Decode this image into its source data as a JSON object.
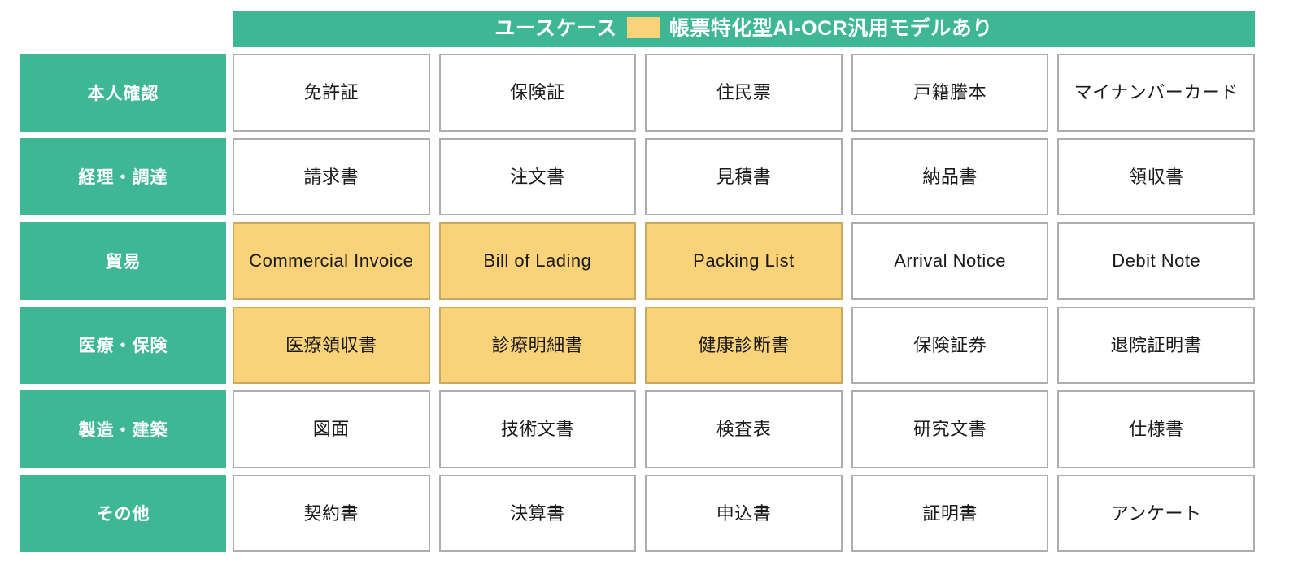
{
  "header": {
    "title": "ユースケース",
    "legend_swatch_color": "#FAD27A",
    "legend_label": "帳票特化型AI-OCR汎用モデルあり",
    "background_color": "#3FB795"
  },
  "colors": {
    "accent_green": "#3FB795",
    "highlight_yellow": "#FAD27A",
    "cell_border": "#ADADAD",
    "text": "#1a1a1a",
    "label_text": "#ffffff"
  },
  "rows": [
    {
      "label": "本人確認",
      "cells": [
        {
          "text": "免許証",
          "highlighted": false
        },
        {
          "text": "保険証",
          "highlighted": false
        },
        {
          "text": "住民票",
          "highlighted": false
        },
        {
          "text": "戸籍謄本",
          "highlighted": false
        },
        {
          "text": "マイナンバーカード",
          "highlighted": false
        }
      ]
    },
    {
      "label": "経理・調達",
      "cells": [
        {
          "text": "請求書",
          "highlighted": false
        },
        {
          "text": "注文書",
          "highlighted": false
        },
        {
          "text": "見積書",
          "highlighted": false
        },
        {
          "text": "納品書",
          "highlighted": false
        },
        {
          "text": "領収書",
          "highlighted": false
        }
      ]
    },
    {
      "label": "貿易",
      "cells": [
        {
          "text": "Commercial Invoice",
          "highlighted": true
        },
        {
          "text": "Bill of Lading",
          "highlighted": true
        },
        {
          "text": "Packing List",
          "highlighted": true
        },
        {
          "text": "Arrival Notice",
          "highlighted": false
        },
        {
          "text": "Debit Note",
          "highlighted": false
        }
      ]
    },
    {
      "label": "医療・保険",
      "cells": [
        {
          "text": "医療領収書",
          "highlighted": true
        },
        {
          "text": "診療明細書",
          "highlighted": true
        },
        {
          "text": "健康診断書",
          "highlighted": true
        },
        {
          "text": "保険証券",
          "highlighted": false
        },
        {
          "text": "退院証明書",
          "highlighted": false
        }
      ]
    },
    {
      "label": "製造・建築",
      "cells": [
        {
          "text": "図面",
          "highlighted": false
        },
        {
          "text": "技術文書",
          "highlighted": false
        },
        {
          "text": "検査表",
          "highlighted": false
        },
        {
          "text": "研究文書",
          "highlighted": false
        },
        {
          "text": "仕様書",
          "highlighted": false
        }
      ]
    },
    {
      "label": "その他",
      "cells": [
        {
          "text": "契約書",
          "highlighted": false
        },
        {
          "text": "決算書",
          "highlighted": false
        },
        {
          "text": "申込書",
          "highlighted": false
        },
        {
          "text": "証明書",
          "highlighted": false
        },
        {
          "text": "アンケート",
          "highlighted": false
        }
      ]
    }
  ]
}
